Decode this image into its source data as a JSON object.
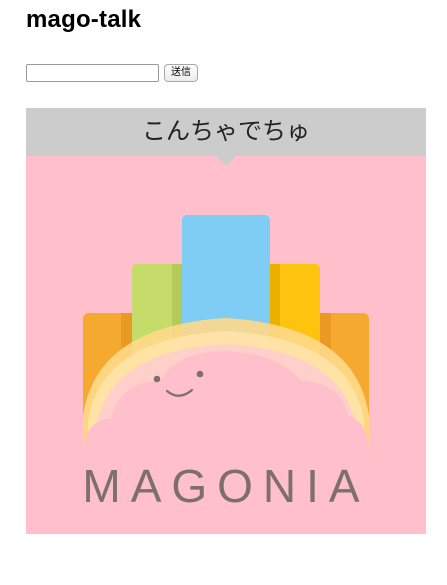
{
  "page": {
    "title": "mago-talk"
  },
  "form": {
    "input_value": "",
    "input_placeholder": "",
    "send_label": "送信"
  },
  "message": {
    "text": "こんちゃでちゅ"
  },
  "logo": {
    "wordmark": "MAGONIA",
    "colors": {
      "card_background": "#ffc0cb",
      "bubble_background": "#cccccc",
      "orange": "#f6a92f",
      "green": "#c6dc6a",
      "blue": "#7fcdf4",
      "yellow": "#fcc40f",
      "wordmark": "#7d6f69"
    }
  }
}
